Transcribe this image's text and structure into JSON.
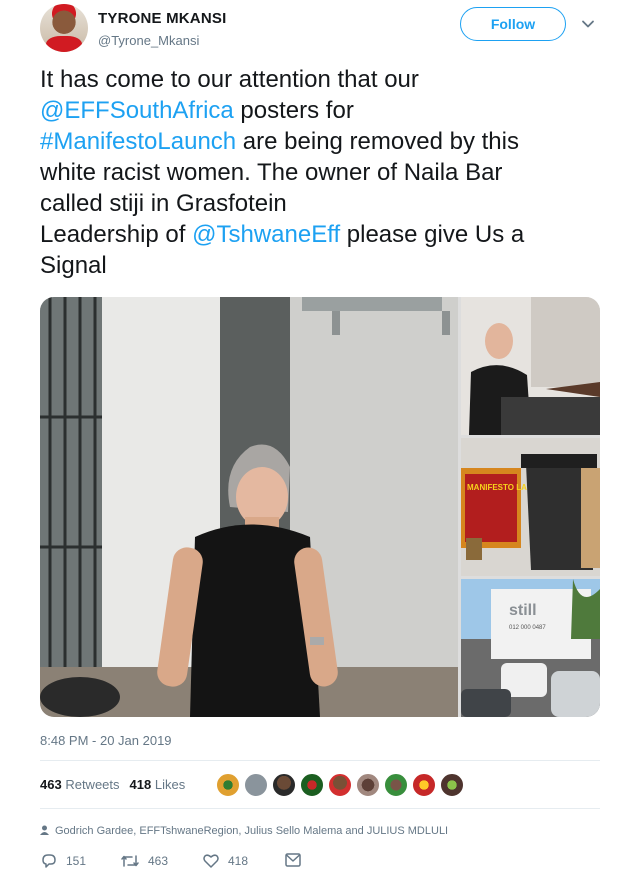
{
  "author": {
    "name": "TYRONE MKANSI",
    "handle": "@Tyrone_Mkansi",
    "follow_label": "Follow"
  },
  "tweet": {
    "lines": [
      [
        {
          "t": "It has come to our attention that our",
          "link": false
        }
      ],
      [
        {
          "t": "@EFFSouthAfrica",
          "link": true
        },
        {
          "t": "  posters for",
          "link": false
        }
      ],
      [
        {
          "t": "#ManifestoLaunch",
          "link": true
        },
        {
          "t": " are being removed by this",
          "link": false
        }
      ],
      [
        {
          "t": "white racist women. The owner of Naila Bar",
          "link": false
        }
      ],
      [
        {
          "t": "called stiji in Grasfotein",
          "link": false
        }
      ],
      [
        {
          "t": "Leadership of ",
          "link": false
        },
        {
          "t": "@TshwaneEff",
          "link": true
        },
        {
          "t": " please give Us a",
          "link": false
        }
      ],
      [
        {
          "t": "Signal",
          "link": false
        }
      ]
    ]
  },
  "media": {
    "poster_text": "MANIFESTO LAUNCH RALLY",
    "sign_text": "still",
    "phone_text": "012 000 0487"
  },
  "timestamp": "8:48 PM - 20 Jan 2019",
  "stats": {
    "retweets_count": "463",
    "retweets_label": "Retweets",
    "likes_count": "418",
    "likes_label": "Likes"
  },
  "liked_by": "Godrich Gardee, EFFTshwaneRegion, Julius Sello Malema and JULIUS MDLULI",
  "actions": {
    "replies": "151",
    "retweets": "463",
    "likes": "418"
  },
  "colors": {
    "link": "#1da1f2",
    "muted": "#657786",
    "text": "#14171a"
  }
}
